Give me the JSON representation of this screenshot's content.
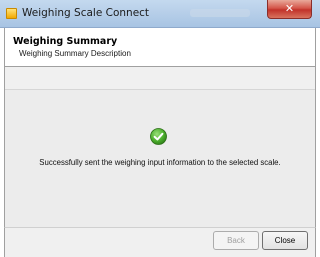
{
  "window": {
    "title": "Weighing Scale Connect",
    "close_glyph": "✕"
  },
  "header": {
    "title": "Weighing Summary",
    "description": "Weighing Summary Description"
  },
  "content": {
    "icon": "success-check-icon",
    "message": "Successfully sent the weighing input information to the selected scale."
  },
  "footer": {
    "back_label": "Back",
    "close_label": "Close"
  },
  "colors": {
    "success_green": "#4caf2d",
    "close_button_red": "#c1322a"
  }
}
